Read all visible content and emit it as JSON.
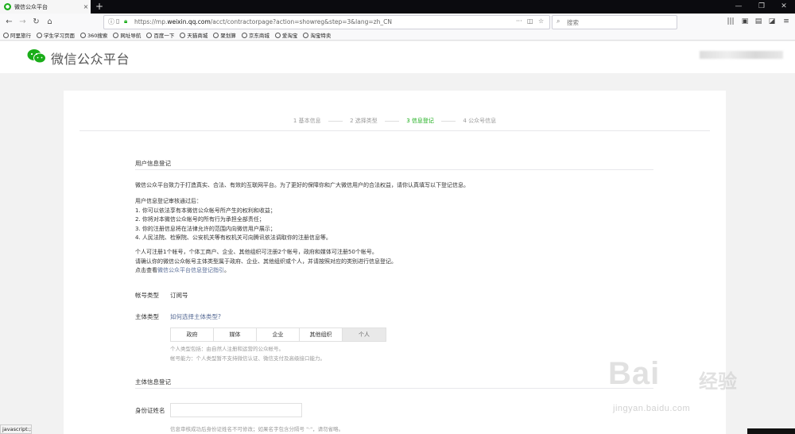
{
  "browser": {
    "tab_title": "微信公众平台",
    "tab_close": "×",
    "new_tab": "+",
    "url_prefix": "https://mp.",
    "url_host": "weixin.qq.com",
    "url_path": "/acct/contractorpage?action=showreg&step=3&lang=zh_CN",
    "url_more": "···",
    "search_placeholder": "搜索",
    "bookmarks": [
      "阿里旅行",
      "学生学习页面",
      "360搜索",
      "网址导航",
      "百度一下",
      "天猫商城",
      "聚划算",
      "京东商城",
      "爱淘宝",
      "淘宝特卖"
    ],
    "status_text": "javascript:;"
  },
  "header": {
    "brand": "微信公众平台",
    "accent": "#1aad19"
  },
  "steps": [
    "1 基本信息",
    "2 选择类型",
    "3 信息登记",
    "4 公众号信息"
  ],
  "section1": {
    "title": "用户信息登记",
    "intro": "微信公众平台致力于打造真实、合法、有效的互联网平台。为了更好的保障你和广大微信用户的合法权益，请你认真填写以下登记信息。",
    "review_title": "用户信息登记审核通过后：",
    "review_items": [
      "1. 你可以依法享有本微信公众帐号所产生的权利和收益；",
      "2. 你将对本微信公众帐号的所有行为承担全部责任；",
      "3. 你的注册信息将在法律允许的范围内向微信用户展示；",
      "4. 人民法院、检察院、公安机关等有权机关可向腾讯依法调取你的注册信息等。"
    ],
    "limits_1": "个人可注册1个帐号，个体工商户、企业、其他组织可注册2个帐号，政府和媒体可注册50个帐号。",
    "limits_2": "请确认你的微信公众帐号主体类型属于政府、企业、其他组织或个人，并请按照对应的类别进行信息登记。",
    "guide_prefix": "点击查看",
    "guide_link": "微信公众平台信息登记指引",
    "guide_suffix": "。"
  },
  "form": {
    "account_type_label": "帐号类型",
    "account_type_value": "订阅号",
    "subject_type_label": "主体类型",
    "subject_help_link": "如何选择主体类型?",
    "subject_options": [
      "政府",
      "媒体",
      "企业",
      "其他组织",
      "个人"
    ],
    "selected_option": "个人",
    "tip1": "个人类型包括：由自然人注册和运营的公众帐号。",
    "tip2": "帐号能力：个人类型暂不支持微信认证、微信支付及高级接口能力。"
  },
  "section2": {
    "title": "主体信息登记",
    "id_name_label": "身份证姓名",
    "id_name_value": "",
    "id_name_tip": "信息审核成功后身份证姓名不可修改；如果名字包含分隔号 \"·\"，请勿省略。"
  },
  "watermark": {
    "big": "Bai",
    "cn": "经验",
    "small": "jingyan.baidu.com"
  }
}
